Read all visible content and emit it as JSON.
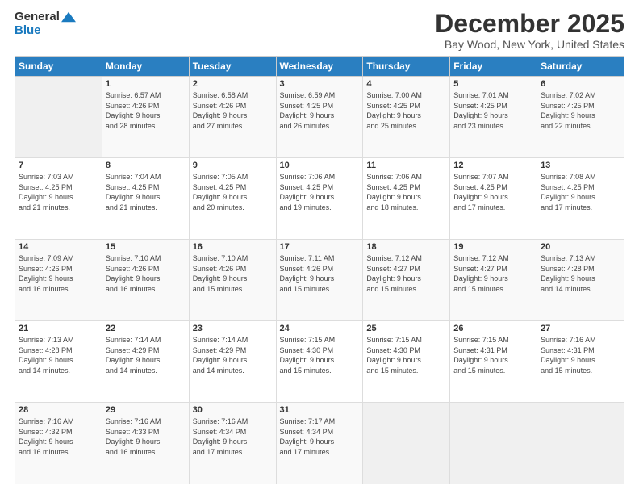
{
  "logo": {
    "general": "General",
    "blue": "Blue"
  },
  "title": "December 2025",
  "location": "Bay Wood, New York, United States",
  "headers": [
    "Sunday",
    "Monday",
    "Tuesday",
    "Wednesday",
    "Thursday",
    "Friday",
    "Saturday"
  ],
  "weeks": [
    [
      {
        "day": "",
        "info": ""
      },
      {
        "day": "1",
        "info": "Sunrise: 6:57 AM\nSunset: 4:26 PM\nDaylight: 9 hours\nand 28 minutes."
      },
      {
        "day": "2",
        "info": "Sunrise: 6:58 AM\nSunset: 4:26 PM\nDaylight: 9 hours\nand 27 minutes."
      },
      {
        "day": "3",
        "info": "Sunrise: 6:59 AM\nSunset: 4:25 PM\nDaylight: 9 hours\nand 26 minutes."
      },
      {
        "day": "4",
        "info": "Sunrise: 7:00 AM\nSunset: 4:25 PM\nDaylight: 9 hours\nand 25 minutes."
      },
      {
        "day": "5",
        "info": "Sunrise: 7:01 AM\nSunset: 4:25 PM\nDaylight: 9 hours\nand 23 minutes."
      },
      {
        "day": "6",
        "info": "Sunrise: 7:02 AM\nSunset: 4:25 PM\nDaylight: 9 hours\nand 22 minutes."
      }
    ],
    [
      {
        "day": "7",
        "info": "Sunrise: 7:03 AM\nSunset: 4:25 PM\nDaylight: 9 hours\nand 21 minutes."
      },
      {
        "day": "8",
        "info": "Sunrise: 7:04 AM\nSunset: 4:25 PM\nDaylight: 9 hours\nand 21 minutes."
      },
      {
        "day": "9",
        "info": "Sunrise: 7:05 AM\nSunset: 4:25 PM\nDaylight: 9 hours\nand 20 minutes."
      },
      {
        "day": "10",
        "info": "Sunrise: 7:06 AM\nSunset: 4:25 PM\nDaylight: 9 hours\nand 19 minutes."
      },
      {
        "day": "11",
        "info": "Sunrise: 7:06 AM\nSunset: 4:25 PM\nDaylight: 9 hours\nand 18 minutes."
      },
      {
        "day": "12",
        "info": "Sunrise: 7:07 AM\nSunset: 4:25 PM\nDaylight: 9 hours\nand 17 minutes."
      },
      {
        "day": "13",
        "info": "Sunrise: 7:08 AM\nSunset: 4:25 PM\nDaylight: 9 hours\nand 17 minutes."
      }
    ],
    [
      {
        "day": "14",
        "info": "Sunrise: 7:09 AM\nSunset: 4:26 PM\nDaylight: 9 hours\nand 16 minutes."
      },
      {
        "day": "15",
        "info": "Sunrise: 7:10 AM\nSunset: 4:26 PM\nDaylight: 9 hours\nand 16 minutes."
      },
      {
        "day": "16",
        "info": "Sunrise: 7:10 AM\nSunset: 4:26 PM\nDaylight: 9 hours\nand 15 minutes."
      },
      {
        "day": "17",
        "info": "Sunrise: 7:11 AM\nSunset: 4:26 PM\nDaylight: 9 hours\nand 15 minutes."
      },
      {
        "day": "18",
        "info": "Sunrise: 7:12 AM\nSunset: 4:27 PM\nDaylight: 9 hours\nand 15 minutes."
      },
      {
        "day": "19",
        "info": "Sunrise: 7:12 AM\nSunset: 4:27 PM\nDaylight: 9 hours\nand 15 minutes."
      },
      {
        "day": "20",
        "info": "Sunrise: 7:13 AM\nSunset: 4:28 PM\nDaylight: 9 hours\nand 14 minutes."
      }
    ],
    [
      {
        "day": "21",
        "info": "Sunrise: 7:13 AM\nSunset: 4:28 PM\nDaylight: 9 hours\nand 14 minutes."
      },
      {
        "day": "22",
        "info": "Sunrise: 7:14 AM\nSunset: 4:29 PM\nDaylight: 9 hours\nand 14 minutes."
      },
      {
        "day": "23",
        "info": "Sunrise: 7:14 AM\nSunset: 4:29 PM\nDaylight: 9 hours\nand 14 minutes."
      },
      {
        "day": "24",
        "info": "Sunrise: 7:15 AM\nSunset: 4:30 PM\nDaylight: 9 hours\nand 15 minutes."
      },
      {
        "day": "25",
        "info": "Sunrise: 7:15 AM\nSunset: 4:30 PM\nDaylight: 9 hours\nand 15 minutes."
      },
      {
        "day": "26",
        "info": "Sunrise: 7:15 AM\nSunset: 4:31 PM\nDaylight: 9 hours\nand 15 minutes."
      },
      {
        "day": "27",
        "info": "Sunrise: 7:16 AM\nSunset: 4:31 PM\nDaylight: 9 hours\nand 15 minutes."
      }
    ],
    [
      {
        "day": "28",
        "info": "Sunrise: 7:16 AM\nSunset: 4:32 PM\nDaylight: 9 hours\nand 16 minutes."
      },
      {
        "day": "29",
        "info": "Sunrise: 7:16 AM\nSunset: 4:33 PM\nDaylight: 9 hours\nand 16 minutes."
      },
      {
        "day": "30",
        "info": "Sunrise: 7:16 AM\nSunset: 4:34 PM\nDaylight: 9 hours\nand 17 minutes."
      },
      {
        "day": "31",
        "info": "Sunrise: 7:17 AM\nSunset: 4:34 PM\nDaylight: 9 hours\nand 17 minutes."
      },
      {
        "day": "",
        "info": ""
      },
      {
        "day": "",
        "info": ""
      },
      {
        "day": "",
        "info": ""
      }
    ]
  ]
}
